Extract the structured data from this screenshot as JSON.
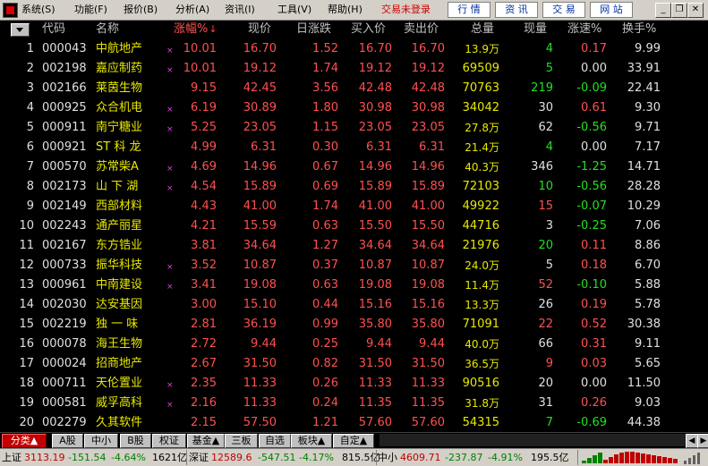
{
  "menu": {
    "items": [
      "系统(S)",
      "功能(F)",
      "报价(B)",
      "分析(A)",
      "资讯(I)",
      "工具(V)",
      "帮助(H)"
    ],
    "status": "交易未登录",
    "buttons": [
      "行 情",
      "资 讯",
      "交 易",
      "网 站"
    ]
  },
  "columns": [
    "代码",
    "名称",
    "涨幅%",
    "现价",
    "日涨跌",
    "买入价",
    "卖出价",
    "总量",
    "现量",
    "涨速%",
    "换手%"
  ],
  "sort_arrow": "↓",
  "rows": [
    {
      "idx": "1",
      "code": "000043",
      "name": "中航地产",
      "mark": "×",
      "change_pct": "10.01",
      "price": "16.70",
      "change": "1.52",
      "bid": "16.70",
      "ask": "16.70",
      "volume": "13.9万",
      "cur_vol": "4",
      "speed": "0.17",
      "turnover": "9.99",
      "cv": "green",
      "sp": "red"
    },
    {
      "idx": "2",
      "code": "002198",
      "name": "嘉应制药",
      "mark": "×",
      "change_pct": "10.01",
      "price": "19.12",
      "change": "1.74",
      "bid": "19.12",
      "ask": "19.12",
      "volume": "69509",
      "cur_vol": "5",
      "speed": "0.00",
      "turnover": "33.91",
      "cv": "green",
      "sp": "white"
    },
    {
      "idx": "3",
      "code": "002166",
      "name": "莱茵生物",
      "mark": "",
      "change_pct": "9.15",
      "price": "42.45",
      "change": "3.56",
      "bid": "42.48",
      "ask": "42.48",
      "volume": "70763",
      "cur_vol": "219",
      "speed": "-0.09",
      "turnover": "22.41",
      "cv": "green",
      "sp": "green"
    },
    {
      "idx": "4",
      "code": "000925",
      "name": "众合机电",
      "mark": "×",
      "change_pct": "6.19",
      "price": "30.89",
      "change": "1.80",
      "bid": "30.98",
      "ask": "30.98",
      "volume": "34042",
      "cur_vol": "30",
      "speed": "0.61",
      "turnover": "9.30",
      "cv": "white",
      "sp": "red"
    },
    {
      "idx": "5",
      "code": "000911",
      "name": "南宁糖业",
      "mark": "×",
      "change_pct": "5.25",
      "price": "23.05",
      "change": "1.15",
      "bid": "23.05",
      "ask": "23.05",
      "volume": "27.8万",
      "cur_vol": "62",
      "speed": "-0.56",
      "turnover": "9.71",
      "cv": "white",
      "sp": "green"
    },
    {
      "idx": "6",
      "code": "000921",
      "name": "ST 科 龙",
      "mark": "",
      "change_pct": "4.99",
      "price": "6.31",
      "change": "0.30",
      "bid": "6.31",
      "ask": "6.31",
      "volume": "21.4万",
      "cur_vol": "4",
      "speed": "0.00",
      "turnover": "7.17",
      "cv": "green",
      "sp": "white"
    },
    {
      "idx": "7",
      "code": "000570",
      "name": "苏常柴A",
      "mark": "×",
      "change_pct": "4.69",
      "price": "14.96",
      "change": "0.67",
      "bid": "14.96",
      "ask": "14.96",
      "volume": "40.3万",
      "cur_vol": "346",
      "speed": "-1.25",
      "turnover": "14.71",
      "cv": "white",
      "sp": "green"
    },
    {
      "idx": "8",
      "code": "002173",
      "name": "山 下 湖",
      "mark": "×",
      "change_pct": "4.54",
      "price": "15.89",
      "change": "0.69",
      "bid": "15.89",
      "ask": "15.89",
      "volume": "72103",
      "cur_vol": "10",
      "speed": "-0.56",
      "turnover": "28.28",
      "cv": "green",
      "sp": "green"
    },
    {
      "idx": "9",
      "code": "002149",
      "name": "西部材料",
      "mark": "",
      "change_pct": "4.43",
      "price": "41.00",
      "change": "1.74",
      "bid": "41.00",
      "ask": "41.00",
      "volume": "49922",
      "cur_vol": "15",
      "speed": "-0.07",
      "turnover": "10.29",
      "cv": "red",
      "sp": "green"
    },
    {
      "idx": "10",
      "code": "002243",
      "name": "通产丽星",
      "mark": "",
      "change_pct": "4.21",
      "price": "15.59",
      "change": "0.63",
      "bid": "15.50",
      "ask": "15.50",
      "volume": "44716",
      "cur_vol": "3",
      "speed": "-0.25",
      "turnover": "7.06",
      "cv": "white",
      "sp": "green"
    },
    {
      "idx": "11",
      "code": "002167",
      "name": "东方锆业",
      "mark": "",
      "change_pct": "3.81",
      "price": "34.64",
      "change": "1.27",
      "bid": "34.64",
      "ask": "34.64",
      "volume": "21976",
      "cur_vol": "20",
      "speed": "0.11",
      "turnover": "8.86",
      "cv": "green",
      "sp": "red"
    },
    {
      "idx": "12",
      "code": "000733",
      "name": "振华科技",
      "mark": "×",
      "change_pct": "3.52",
      "price": "10.87",
      "change": "0.37",
      "bid": "10.87",
      "ask": "10.87",
      "volume": "24.0万",
      "cur_vol": "5",
      "speed": "0.18",
      "turnover": "6.70",
      "cv": "white",
      "sp": "red"
    },
    {
      "idx": "13",
      "code": "000961",
      "name": "中南建设",
      "mark": "×",
      "change_pct": "3.41",
      "price": "19.08",
      "change": "0.63",
      "bid": "19.08",
      "ask": "19.08",
      "volume": "11.4万",
      "cur_vol": "52",
      "speed": "-0.10",
      "turnover": "5.88",
      "cv": "red",
      "sp": "green"
    },
    {
      "idx": "14",
      "code": "002030",
      "name": "达安基因",
      "mark": "",
      "change_pct": "3.00",
      "price": "15.10",
      "change": "0.44",
      "bid": "15.16",
      "ask": "15.16",
      "volume": "13.3万",
      "cur_vol": "26",
      "speed": "0.19",
      "turnover": "5.78",
      "cv": "white",
      "sp": "red"
    },
    {
      "idx": "15",
      "code": "002219",
      "name": "独 一 味",
      "mark": "",
      "change_pct": "2.81",
      "price": "36.19",
      "change": "0.99",
      "bid": "35.80",
      "ask": "35.80",
      "volume": "71091",
      "cur_vol": "22",
      "speed": "0.52",
      "turnover": "30.38",
      "cv": "red",
      "sp": "red"
    },
    {
      "idx": "16",
      "code": "000078",
      "name": "海王生物",
      "mark": "",
      "change_pct": "2.72",
      "price": "9.44",
      "change": "0.25",
      "bid": "9.44",
      "ask": "9.44",
      "volume": "40.0万",
      "cur_vol": "66",
      "speed": "0.31",
      "turnover": "9.11",
      "cv": "white",
      "sp": "red"
    },
    {
      "idx": "17",
      "code": "000024",
      "name": "招商地产",
      "mark": "",
      "change_pct": "2.67",
      "price": "31.50",
      "change": "0.82",
      "bid": "31.50",
      "ask": "31.50",
      "volume": "36.5万",
      "cur_vol": "9",
      "speed": "0.03",
      "turnover": "5.65",
      "cv": "red",
      "sp": "red"
    },
    {
      "idx": "18",
      "code": "000711",
      "name": "天伦置业",
      "mark": "×",
      "change_pct": "2.35",
      "price": "11.33",
      "change": "0.26",
      "bid": "11.33",
      "ask": "11.33",
      "volume": "90516",
      "cur_vol": "20",
      "speed": "0.00",
      "turnover": "11.50",
      "cv": "white",
      "sp": "white"
    },
    {
      "idx": "19",
      "code": "000581",
      "name": "威孚高科",
      "mark": "×",
      "change_pct": "2.16",
      "price": "11.33",
      "change": "0.24",
      "bid": "11.35",
      "ask": "11.35",
      "volume": "31.8万",
      "cur_vol": "31",
      "speed": "0.26",
      "turnover": "9.03",
      "cv": "white",
      "sp": "red"
    },
    {
      "idx": "20",
      "code": "002279",
      "name": "久其软件",
      "mark": "",
      "change_pct": "2.15",
      "price": "57.50",
      "change": "1.21",
      "bid": "57.60",
      "ask": "57.60",
      "volume": "54315",
      "cur_vol": "7",
      "speed": "-0.69",
      "turnover": "44.38",
      "cv": "green",
      "sp": "green"
    }
  ],
  "tabs": [
    "分类▲",
    "A股",
    "中小",
    "B股",
    "权证",
    "基金▲",
    "三板",
    "自选",
    "板块▲",
    "自定▲"
  ],
  "status": {
    "sh_label": "上证",
    "sh_index": "3113.19",
    "sh_change": "-151.54",
    "sh_pct": "-4.64%",
    "sh_amount": "1621亿",
    "sz_label": "深证",
    "sz_index": "12589.6",
    "sz_change": "-547.51",
    "sz_pct": "-4.17%",
    "sz_amount": "815.5亿",
    "zx_label": "中小",
    "zx_index": "4609.71",
    "zx_change": "-237.87",
    "zx_pct": "-4.91%",
    "zx_amount": "195.5亿"
  },
  "colors": {
    "up": "#ff5050",
    "down": "#20e020",
    "name": "#e8e800",
    "flat": "#e0e0e0",
    "active_tab": "#c00000"
  }
}
